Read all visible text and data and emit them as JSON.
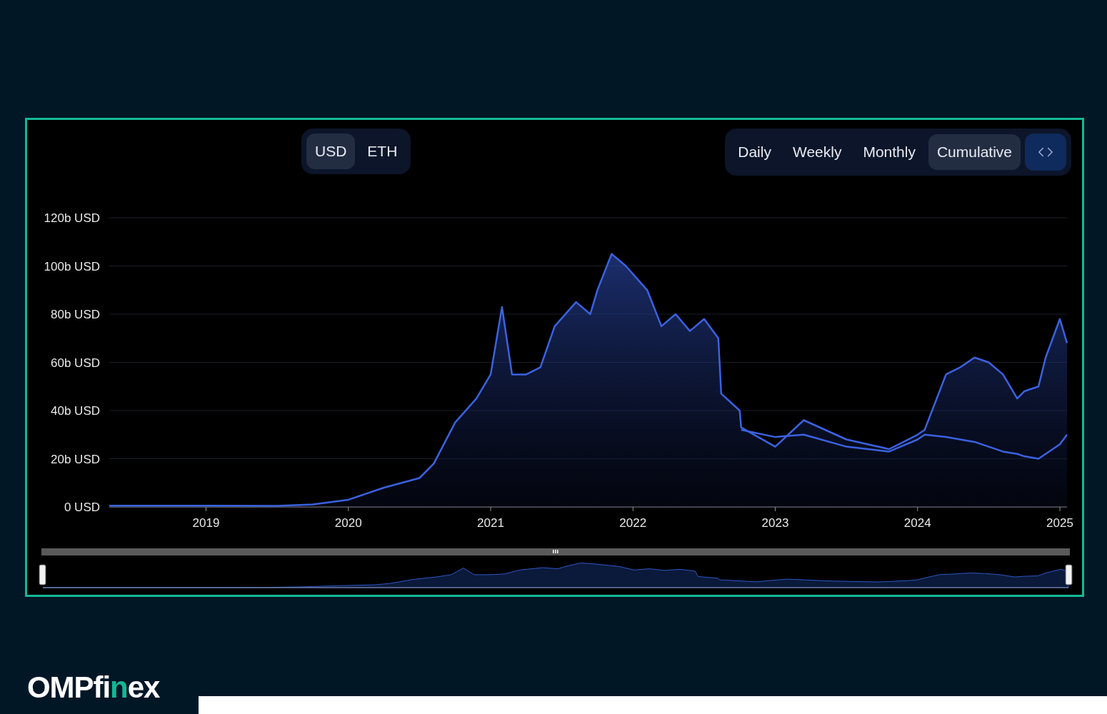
{
  "currency_toggle": [
    {
      "label": "USD",
      "selected": true
    },
    {
      "label": "ETH",
      "selected": false
    }
  ],
  "period_tabs": [
    {
      "label": "Daily",
      "selected": false
    },
    {
      "label": "Weekly",
      "selected": false
    },
    {
      "label": "Monthly",
      "selected": false
    },
    {
      "label": "Cumulative",
      "selected": true
    }
  ],
  "chart_data": {
    "type": "area",
    "x": [
      2018.32,
      2019,
      2019.5,
      2019.75,
      2020,
      2020.25,
      2020.5,
      2020.6,
      2020.75,
      2020.9,
      2021,
      2021.08,
      2021.15,
      2021.25,
      2021.35,
      2021.45,
      2021.6,
      2021.7,
      2021.75,
      2021.85,
      2021.95,
      2022.1,
      2022.2,
      2022.3,
      2022.4,
      2022.5,
      2022.6,
      2022.62,
      2022.75,
      2022.76,
      2023.0,
      2023.2,
      2023.5,
      2023.8,
      2024.0,
      2024.05,
      2024.2,
      2024.3,
      2024.4,
      2024.5,
      2024.6,
      2024.7,
      2024.75,
      2024.85,
      2024.9,
      2025.0,
      2025.05
    ],
    "series": [
      {
        "type": "area",
        "color": "#3b62e0",
        "values": [
          0.5,
          0.5,
          0.4,
          1,
          3,
          8,
          12,
          18,
          35,
          45,
          55,
          83,
          55,
          55,
          58,
          75,
          85,
          80,
          90,
          105,
          100,
          90,
          75,
          80,
          73,
          78,
          70,
          47,
          40,
          33,
          25,
          36,
          28,
          24,
          30,
          32,
          55,
          58,
          62,
          60,
          55,
          45,
          48,
          50,
          62,
          78,
          68
        ]
      },
      {
        "type": "line",
        "color": "#3b62e0",
        "values": [
          null,
          null,
          null,
          null,
          null,
          null,
          null,
          null,
          null,
          null,
          null,
          null,
          null,
          null,
          null,
          null,
          null,
          null,
          null,
          null,
          null,
          null,
          null,
          null,
          null,
          null,
          null,
          null,
          null,
          32,
          29,
          30,
          25,
          23,
          28,
          30,
          29,
          28,
          27,
          25,
          23,
          22,
          21,
          20,
          22,
          26,
          30
        ]
      }
    ],
    "grid": true,
    "ylim": [
      0,
      120
    ],
    "xlim": [
      2018.32,
      2025.05
    ],
    "yticks": [
      {
        "value": 0,
        "label": "0 USD"
      },
      {
        "value": 20,
        "label": "20b USD"
      },
      {
        "value": 40,
        "label": "40b USD"
      },
      {
        "value": 60,
        "label": "60b USD"
      },
      {
        "value": 80,
        "label": "80b USD"
      },
      {
        "value": 100,
        "label": "100b USD"
      },
      {
        "value": 120,
        "label": "120b USD"
      }
    ],
    "xticks": [
      2019,
      2020,
      2021,
      2022,
      2023,
      2024,
      2025
    ]
  },
  "logo": {
    "text": "OMPfinex"
  }
}
